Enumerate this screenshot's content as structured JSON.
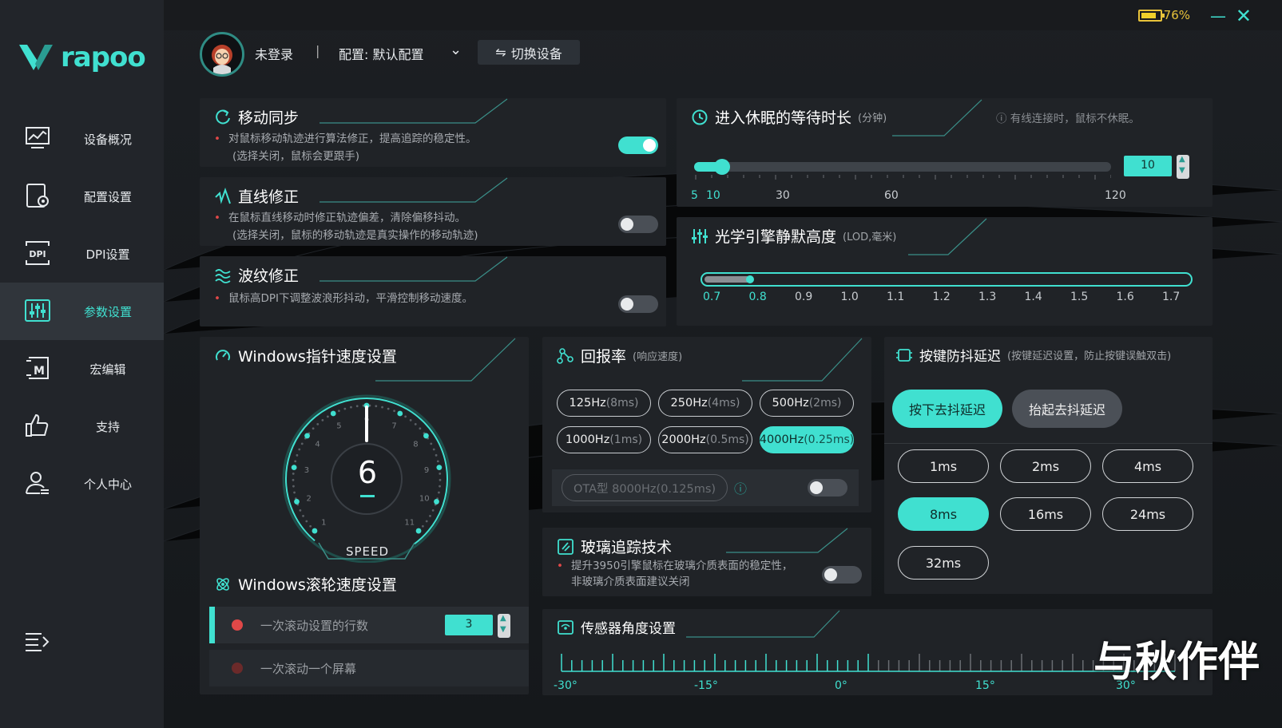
{
  "brand": {
    "name": "rapoo"
  },
  "window": {
    "battery_pct": "76%",
    "minimize_icon": "minimize-icon",
    "close_icon": "close-icon"
  },
  "sidebar": {
    "items": [
      {
        "label": "设备概况",
        "icon": "monitor-chart-icon"
      },
      {
        "label": "配置设置",
        "icon": "config-icon"
      },
      {
        "label": "DPI设置",
        "icon": "dpi-icon"
      },
      {
        "label": "参数设置",
        "icon": "sliders-icon",
        "active": true
      },
      {
        "label": "宏编辑",
        "icon": "macro-icon"
      },
      {
        "label": "支持",
        "icon": "thumbs-up-icon"
      },
      {
        "label": "个人中心",
        "icon": "user-icon"
      }
    ]
  },
  "header": {
    "user": "未登录",
    "separator": "|",
    "config_label": "配置: 默认配置",
    "switch_device": "切换设备"
  },
  "motion_sync": {
    "title": "移动同步",
    "desc1": "对鼠标移动轨迹进行算法修正，提高追踪的稳定性。",
    "desc2": "(选择关闭，鼠标会更跟手)",
    "on": true
  },
  "line_fix": {
    "title": "直线修正",
    "desc1": "在鼠标直线移动时修正轨迹偏差，清除偏移抖动。",
    "desc2": "(选择关闭，鼠标的移动轨迹是真实操作的移动轨迹)",
    "on": false
  },
  "ripple_fix": {
    "title": "波纹修正",
    "desc1": "鼠标高DPI下调整波浪形抖动，平滑控制移动速度。",
    "on": false
  },
  "sleep": {
    "title": "进入休眠的等待时长",
    "unit": "(分钟)",
    "note": "有线连接时，鼠标不休眠。",
    "value": "10",
    "ticks": [
      "5",
      "10",
      "30",
      "60",
      "120"
    ],
    "value_num": 10,
    "min": 5,
    "max": 120
  },
  "lod": {
    "title": "光学引擎静默高度",
    "unit": "(LOD,毫米)",
    "ticks": [
      "0.7",
      "0.8",
      "0.9",
      "1.0",
      "1.1",
      "1.2",
      "1.3",
      "1.4",
      "1.5",
      "1.6",
      "1.7"
    ],
    "selected": "0.8"
  },
  "pointer": {
    "title": "Windows指针速度设置",
    "value": "6",
    "speed_label": "SPEED",
    "dial_numbers": [
      "1",
      "2",
      "3",
      "4",
      "5",
      "6",
      "7",
      "8",
      "9",
      "10",
      "11"
    ]
  },
  "wheel": {
    "title": "Windows滚轮速度设置",
    "opt1": "一次滚动设置的行数",
    "opt1_value": "3",
    "opt2": "一次滚动一个屏幕"
  },
  "polling": {
    "title": "回报率",
    "unit": "(响应速度)",
    "options": [
      {
        "hz": "125Hz",
        "ms": "(8ms)"
      },
      {
        "hz": "250Hz",
        "ms": "(4ms)"
      },
      {
        "hz": "500Hz",
        "ms": "(2ms)"
      },
      {
        "hz": "1000Hz",
        "ms": "(1ms)"
      },
      {
        "hz": "2000Hz",
        "ms": "(0.5ms)"
      },
      {
        "hz": "4000Hz",
        "ms": "(0.25ms)",
        "selected": true
      }
    ],
    "ota": "OTA型 8000Hz(0.125ms)"
  },
  "debounce": {
    "title": "按键防抖延迟",
    "subtitle": "(按键延迟设置，防止按键误触双击)",
    "press": "按下去抖延迟",
    "release": "抬起去抖延迟",
    "options": [
      "1ms",
      "2ms",
      "4ms",
      "8ms",
      "16ms",
      "24ms",
      "32ms"
    ],
    "selected": "8ms"
  },
  "glass": {
    "title": "玻璃追踪技术",
    "desc1": "提升3950引擎鼠标在玻璃介质表面的稳定性，",
    "desc2": "非玻璃介质表面建议关闭",
    "on": false
  },
  "sensor_angle": {
    "title": "传感器角度设置",
    "ticks": [
      "-30°",
      "-15°",
      "0°",
      "15°",
      "30°"
    ]
  },
  "watermark": "与秋作伴",
  "colors": {
    "accent": "#40e0d0",
    "bg": "#1a1d21",
    "panel": "#202327",
    "red": "#e04848",
    "battery": "#e8c33a"
  }
}
